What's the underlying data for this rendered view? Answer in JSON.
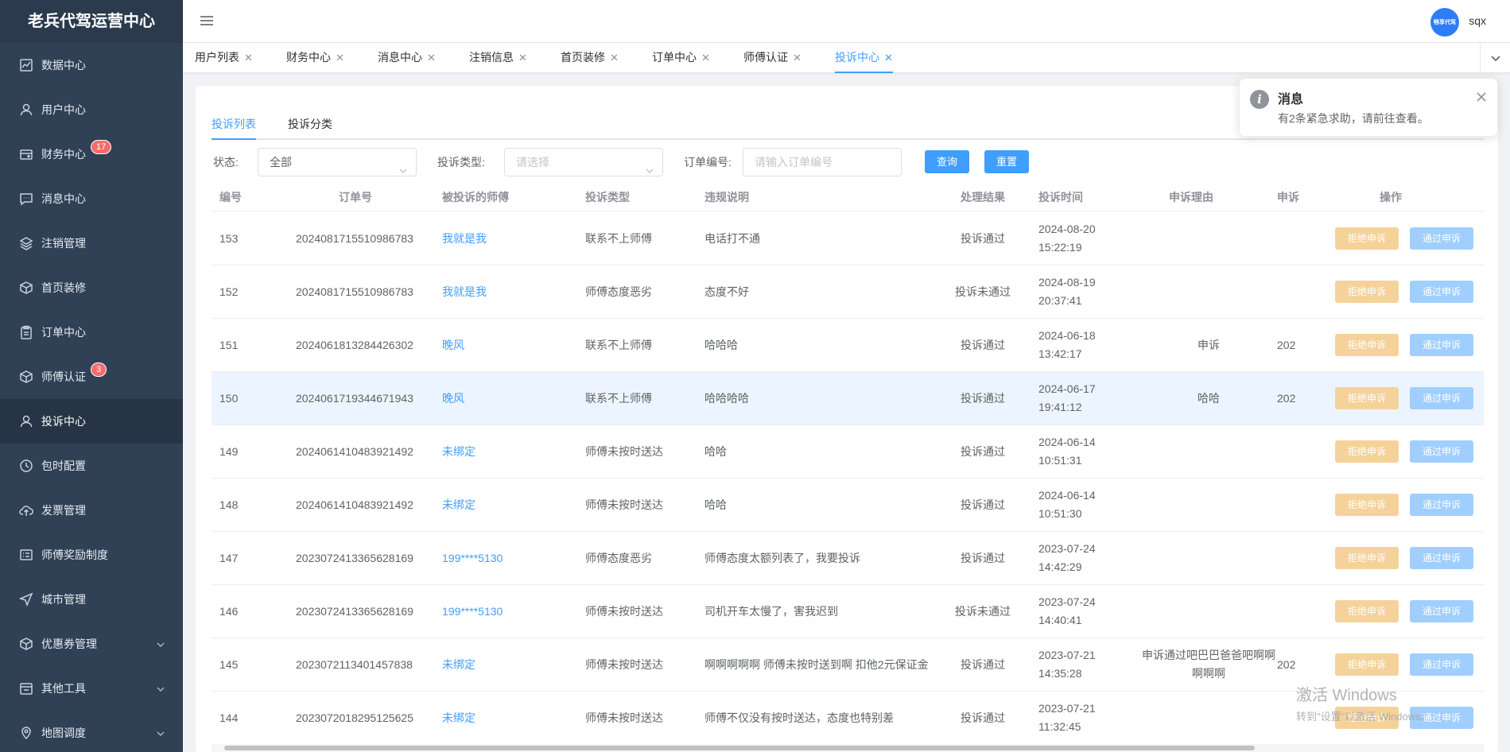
{
  "app": {
    "brand": "老兵代驾运营中心"
  },
  "sidebar": {
    "items": [
      {
        "label": "数据中心",
        "icon": "chart-icon"
      },
      {
        "label": "用户中心",
        "icon": "user-icon"
      },
      {
        "label": "财务中心",
        "icon": "wallet-icon",
        "badge": "17"
      },
      {
        "label": "消息中心",
        "icon": "message-icon"
      },
      {
        "label": "注销管理",
        "icon": "layers-icon"
      },
      {
        "label": "首页装修",
        "icon": "box-icon"
      },
      {
        "label": "订单中心",
        "icon": "clipboard-icon"
      },
      {
        "label": "师傅认证",
        "icon": "box-icon",
        "badge": "3"
      },
      {
        "label": "投诉中心",
        "icon": "user-icon",
        "active": true
      },
      {
        "label": "包时配置",
        "icon": "clock-icon"
      },
      {
        "label": "发票管理",
        "icon": "cloud-upload-icon"
      },
      {
        "label": "师傅奖励制度",
        "icon": "list-icon"
      },
      {
        "label": "城市管理",
        "icon": "navigation-icon"
      },
      {
        "label": "优惠券管理",
        "icon": "box-icon",
        "expandable": true
      },
      {
        "label": "其他工具",
        "icon": "calendar-icon",
        "expandable": true
      },
      {
        "label": "地图调度",
        "icon": "location-icon",
        "expandable": true
      }
    ]
  },
  "header": {
    "avatar_text": "畅享代驾",
    "username": "sqx"
  },
  "tabs": [
    {
      "label": "用户列表"
    },
    {
      "label": "财务中心"
    },
    {
      "label": "消息中心"
    },
    {
      "label": "注销信息"
    },
    {
      "label": "首页装修"
    },
    {
      "label": "订单中心"
    },
    {
      "label": "师傅认证"
    },
    {
      "label": "投诉中心",
      "active": true
    }
  ],
  "subtabs": [
    {
      "label": "投诉列表",
      "active": true
    },
    {
      "label": "投诉分类"
    }
  ],
  "filters": {
    "status_label": "状态:",
    "status_value": "全部",
    "type_label": "投诉类型:",
    "type_placeholder": "请选择",
    "order_label": "订单编号:",
    "order_placeholder": "请输入订单编号",
    "query_button": "查询",
    "reset_button": "重置"
  },
  "table": {
    "headers": [
      "编号",
      "订单号",
      "被投诉的师傅",
      "投诉类型",
      "违规说明",
      "处理结果",
      "投诉时间",
      "申诉理由",
      "申诉",
      "操作"
    ],
    "reject_label": "拒绝申诉",
    "pass_label": "通过申诉",
    "rows": [
      {
        "id": "153",
        "order": "2024081715510986783",
        "driver": "我就是我",
        "type": "联系不上师傅",
        "desc": "电话打不通",
        "result": "投诉通过",
        "date": "2024-08-20",
        "time": "15:22:19",
        "reason": "",
        "appeal": ""
      },
      {
        "id": "152",
        "order": "2024081715510986783",
        "driver": "我就是我",
        "type": "师傅态度恶劣",
        "desc": "态度不好",
        "result": "投诉未通过",
        "date": "2024-08-19",
        "time": "20:37:41",
        "reason": "",
        "appeal": ""
      },
      {
        "id": "151",
        "order": "2024061813284426302",
        "driver": "晚风",
        "type": "联系不上师傅",
        "desc": "哈哈哈",
        "result": "投诉通过",
        "date": "2024-06-18",
        "time": "13:42:17",
        "reason": "申诉",
        "appeal": "202"
      },
      {
        "id": "150",
        "order": "2024061719344671943",
        "driver": "晚风",
        "type": "联系不上师傅",
        "desc": "哈哈哈哈",
        "result": "投诉通过",
        "date": "2024-06-17",
        "time": "19:41:12",
        "reason": "哈哈",
        "appeal": "202",
        "highlight": true
      },
      {
        "id": "149",
        "order": "2024061410483921492",
        "driver": "未绑定",
        "type": "师傅未按时送达",
        "desc": "哈哈",
        "result": "投诉通过",
        "date": "2024-06-14",
        "time": "10:51:31",
        "reason": "",
        "appeal": ""
      },
      {
        "id": "148",
        "order": "2024061410483921492",
        "driver": "未绑定",
        "type": "师傅未按时送达",
        "desc": "哈哈",
        "result": "投诉通过",
        "date": "2024-06-14",
        "time": "10:51:30",
        "reason": "",
        "appeal": ""
      },
      {
        "id": "147",
        "order": "2023072413365628169",
        "driver": "199****5130",
        "type": "师傅态度恶劣",
        "desc": "师傅态度太额列表了，我要投诉",
        "result": "投诉通过",
        "date": "2023-07-24",
        "time": "14:42:29",
        "reason": "",
        "appeal": ""
      },
      {
        "id": "146",
        "order": "2023072413365628169",
        "driver": "199****5130",
        "type": "师傅未按时送达",
        "desc": "司机开车太慢了，害我迟到",
        "result": "投诉未通过",
        "date": "2023-07-24",
        "time": "14:40:41",
        "reason": "",
        "appeal": ""
      },
      {
        "id": "145",
        "order": "2023072113401457838",
        "driver": "未绑定",
        "type": "师傅未按时送达",
        "desc": "啊啊啊啊啊 师傅未按时送到啊 扣他2元保证金",
        "result": "投诉通过",
        "date": "2023-07-21",
        "time": "14:35:28",
        "reason": "申诉通过吧巴巴爸爸吧啊啊啊啊啊",
        "appeal": "202"
      },
      {
        "id": "144",
        "order": "2023072018295125625",
        "driver": "未绑定",
        "type": "师傅未按时送达",
        "desc": "师傅不仅没有按时送达，态度也特别差",
        "result": "投诉通过",
        "date": "2023-07-21",
        "time": "11:32:45",
        "reason": "",
        "appeal": ""
      }
    ]
  },
  "notification": {
    "title": "消息",
    "message": "有2条紧急求助，请前往查看。"
  },
  "watermark": {
    "line1": "激活 Windows",
    "line2": "转到\"设置\"以激活 Windows。"
  }
}
